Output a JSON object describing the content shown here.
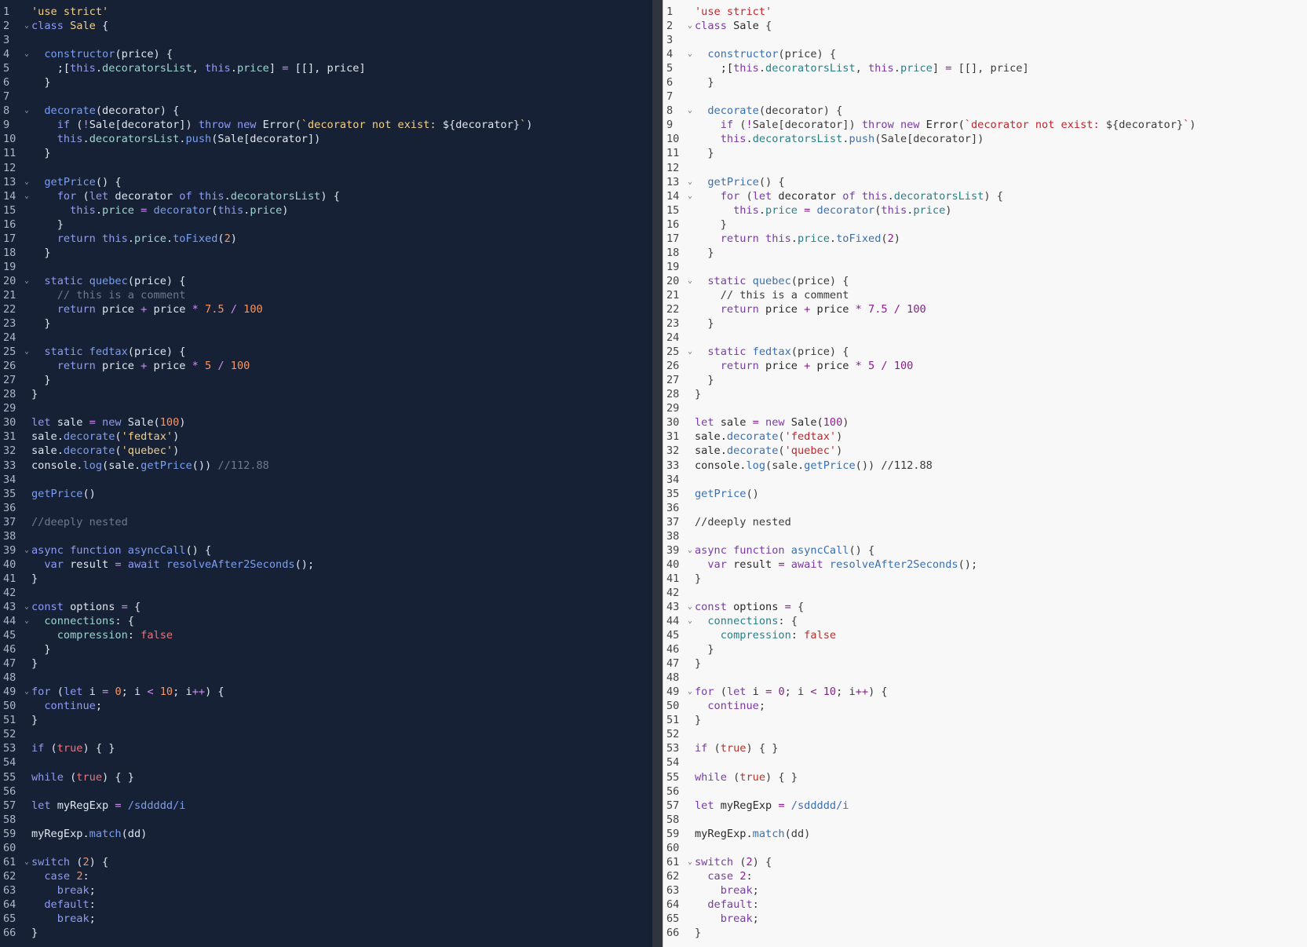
{
  "editors": [
    {
      "name": "dark-editor",
      "theme": "dark",
      "background": "#172136"
    },
    {
      "name": "light-editor",
      "theme": "light",
      "background": "#f8f8f8"
    }
  ],
  "fold_icon": "chevron-down-icon",
  "lines": [
    {
      "n": "1",
      "fold": false,
      "tokens": [
        [
          "str",
          "'use strict'"
        ]
      ]
    },
    {
      "n": "2",
      "fold": true,
      "tokens": [
        [
          "kw",
          "class"
        ],
        [
          "txt",
          " "
        ],
        [
          "cls",
          "Sale"
        ],
        [
          "pun",
          " {"
        ]
      ]
    },
    {
      "n": "3",
      "fold": false,
      "tokens": []
    },
    {
      "n": "4",
      "fold": true,
      "tokens": [
        [
          "txt",
          "  "
        ],
        [
          "fn",
          "constructor"
        ],
        [
          "pun",
          "(price) {"
        ]
      ]
    },
    {
      "n": "5",
      "fold": false,
      "tokens": [
        [
          "txt",
          "    ;["
        ],
        [
          "kw",
          "this"
        ],
        [
          "pun",
          "."
        ],
        [
          "prop",
          "decoratorsList"
        ],
        [
          "pun",
          ", "
        ],
        [
          "kw",
          "this"
        ],
        [
          "pun",
          "."
        ],
        [
          "prop",
          "price"
        ],
        [
          "pun",
          "] "
        ],
        [
          "op",
          "="
        ],
        [
          "pun",
          " [[], price]"
        ]
      ]
    },
    {
      "n": "6",
      "fold": false,
      "tokens": [
        [
          "pun",
          "  }"
        ]
      ]
    },
    {
      "n": "7",
      "fold": false,
      "tokens": []
    },
    {
      "n": "8",
      "fold": true,
      "tokens": [
        [
          "txt",
          "  "
        ],
        [
          "fn",
          "decorate"
        ],
        [
          "pun",
          "(decorator) {"
        ]
      ]
    },
    {
      "n": "9",
      "fold": false,
      "tokens": [
        [
          "txt",
          "    "
        ],
        [
          "kw",
          "if"
        ],
        [
          "pun",
          " ("
        ],
        [
          "op",
          "!"
        ],
        [
          "pun",
          "Sale[decorator]) "
        ],
        [
          "kw",
          "throw"
        ],
        [
          "txt",
          " "
        ],
        [
          "kw",
          "new"
        ],
        [
          "txt",
          " Error("
        ],
        [
          "str",
          "`decorator not exist: "
        ],
        [
          "pun",
          "${decorator}"
        ],
        [
          "str",
          "`"
        ],
        [
          "pun",
          ")"
        ]
      ]
    },
    {
      "n": "10",
      "fold": false,
      "tokens": [
        [
          "txt",
          "    "
        ],
        [
          "kw",
          "this"
        ],
        [
          "pun",
          "."
        ],
        [
          "prop",
          "decoratorsList"
        ],
        [
          "pun",
          "."
        ],
        [
          "fn",
          "push"
        ],
        [
          "pun",
          "(Sale[decorator])"
        ]
      ]
    },
    {
      "n": "11",
      "fold": false,
      "tokens": [
        [
          "pun",
          "  }"
        ]
      ]
    },
    {
      "n": "12",
      "fold": false,
      "tokens": []
    },
    {
      "n": "13",
      "fold": true,
      "tokens": [
        [
          "txt",
          "  "
        ],
        [
          "fn",
          "getPrice"
        ],
        [
          "pun",
          "() {"
        ]
      ]
    },
    {
      "n": "14",
      "fold": true,
      "tokens": [
        [
          "txt",
          "    "
        ],
        [
          "kw",
          "for"
        ],
        [
          "pun",
          " ("
        ],
        [
          "kw",
          "let"
        ],
        [
          "txt",
          " decorator "
        ],
        [
          "kw",
          "of"
        ],
        [
          "txt",
          " "
        ],
        [
          "kw",
          "this"
        ],
        [
          "pun",
          "."
        ],
        [
          "prop",
          "decoratorsList"
        ],
        [
          "pun",
          ") {"
        ]
      ]
    },
    {
      "n": "15",
      "fold": false,
      "tokens": [
        [
          "txt",
          "      "
        ],
        [
          "kw",
          "this"
        ],
        [
          "pun",
          "."
        ],
        [
          "prop",
          "price"
        ],
        [
          "txt",
          " "
        ],
        [
          "op",
          "="
        ],
        [
          "txt",
          " "
        ],
        [
          "fn",
          "decorator"
        ],
        [
          "pun",
          "("
        ],
        [
          "kw",
          "this"
        ],
        [
          "pun",
          "."
        ],
        [
          "prop",
          "price"
        ],
        [
          "pun",
          ")"
        ]
      ]
    },
    {
      "n": "16",
      "fold": false,
      "tokens": [
        [
          "pun",
          "    }"
        ]
      ]
    },
    {
      "n": "17",
      "fold": false,
      "tokens": [
        [
          "txt",
          "    "
        ],
        [
          "kw",
          "return"
        ],
        [
          "txt",
          " "
        ],
        [
          "kw",
          "this"
        ],
        [
          "pun",
          "."
        ],
        [
          "prop",
          "price"
        ],
        [
          "pun",
          "."
        ],
        [
          "fn",
          "toFixed"
        ],
        [
          "pun",
          "("
        ],
        [
          "num",
          "2"
        ],
        [
          "pun",
          ")"
        ]
      ]
    },
    {
      "n": "18",
      "fold": false,
      "tokens": [
        [
          "pun",
          "  }"
        ]
      ]
    },
    {
      "n": "19",
      "fold": false,
      "tokens": []
    },
    {
      "n": "20",
      "fold": true,
      "tokens": [
        [
          "txt",
          "  "
        ],
        [
          "kw",
          "static"
        ],
        [
          "txt",
          " "
        ],
        [
          "fn",
          "quebec"
        ],
        [
          "pun",
          "(price) {"
        ]
      ]
    },
    {
      "n": "21",
      "fold": false,
      "tokens": [
        [
          "txt",
          "    "
        ],
        [
          "com",
          "// this is a comment"
        ]
      ]
    },
    {
      "n": "22",
      "fold": false,
      "tokens": [
        [
          "txt",
          "    "
        ],
        [
          "kw",
          "return"
        ],
        [
          "txt",
          " price "
        ],
        [
          "op",
          "+"
        ],
        [
          "txt",
          " price "
        ],
        [
          "op",
          "*"
        ],
        [
          "txt",
          " "
        ],
        [
          "num",
          "7.5"
        ],
        [
          "txt",
          " "
        ],
        [
          "op",
          "/"
        ],
        [
          "txt",
          " "
        ],
        [
          "num",
          "100"
        ]
      ]
    },
    {
      "n": "23",
      "fold": false,
      "tokens": [
        [
          "pun",
          "  }"
        ]
      ]
    },
    {
      "n": "24",
      "fold": false,
      "tokens": []
    },
    {
      "n": "25",
      "fold": true,
      "tokens": [
        [
          "txt",
          "  "
        ],
        [
          "kw",
          "static"
        ],
        [
          "txt",
          " "
        ],
        [
          "fn",
          "fedtax"
        ],
        [
          "pun",
          "(price) {"
        ]
      ]
    },
    {
      "n": "26",
      "fold": false,
      "tokens": [
        [
          "txt",
          "    "
        ],
        [
          "kw",
          "return"
        ],
        [
          "txt",
          " price "
        ],
        [
          "op",
          "+"
        ],
        [
          "txt",
          " price "
        ],
        [
          "op",
          "*"
        ],
        [
          "txt",
          " "
        ],
        [
          "num",
          "5"
        ],
        [
          "txt",
          " "
        ],
        [
          "op",
          "/"
        ],
        [
          "txt",
          " "
        ],
        [
          "num",
          "100"
        ]
      ]
    },
    {
      "n": "27",
      "fold": false,
      "tokens": [
        [
          "pun",
          "  }"
        ]
      ]
    },
    {
      "n": "28",
      "fold": false,
      "tokens": [
        [
          "pun",
          "}"
        ]
      ]
    },
    {
      "n": "29",
      "fold": false,
      "tokens": []
    },
    {
      "n": "30",
      "fold": false,
      "tokens": [
        [
          "kw",
          "let"
        ],
        [
          "txt",
          " sale "
        ],
        [
          "op",
          "="
        ],
        [
          "txt",
          " "
        ],
        [
          "kw",
          "new"
        ],
        [
          "txt",
          " Sale("
        ],
        [
          "num",
          "100"
        ],
        [
          "pun",
          ")"
        ]
      ]
    },
    {
      "n": "31",
      "fold": false,
      "tokens": [
        [
          "txt",
          "sale."
        ],
        [
          "fn",
          "decorate"
        ],
        [
          "pun",
          "("
        ],
        [
          "str",
          "'fedtax'"
        ],
        [
          "pun",
          ")"
        ]
      ]
    },
    {
      "n": "32",
      "fold": false,
      "tokens": [
        [
          "txt",
          "sale."
        ],
        [
          "fn",
          "decorate"
        ],
        [
          "pun",
          "("
        ],
        [
          "str",
          "'quebec'"
        ],
        [
          "pun",
          ")"
        ]
      ]
    },
    {
      "n": "33",
      "fold": false,
      "tokens": [
        [
          "txt",
          "console."
        ],
        [
          "fn",
          "log"
        ],
        [
          "pun",
          "(sale."
        ],
        [
          "fn",
          "getPrice"
        ],
        [
          "pun",
          "()) "
        ],
        [
          "com",
          "//112.88"
        ]
      ]
    },
    {
      "n": "34",
      "fold": false,
      "tokens": []
    },
    {
      "n": "35",
      "fold": false,
      "tokens": [
        [
          "fn",
          "getPrice"
        ],
        [
          "pun",
          "()"
        ]
      ]
    },
    {
      "n": "36",
      "fold": false,
      "tokens": []
    },
    {
      "n": "37",
      "fold": false,
      "tokens": [
        [
          "com",
          "//deeply nested"
        ]
      ]
    },
    {
      "n": "38",
      "fold": false,
      "tokens": []
    },
    {
      "n": "39",
      "fold": true,
      "tokens": [
        [
          "kw",
          "async"
        ],
        [
          "txt",
          " "
        ],
        [
          "kw",
          "function"
        ],
        [
          "txt",
          " "
        ],
        [
          "fn",
          "asyncCall"
        ],
        [
          "pun",
          "() {"
        ]
      ]
    },
    {
      "n": "40",
      "fold": false,
      "tokens": [
        [
          "txt",
          "  "
        ],
        [
          "kw",
          "var"
        ],
        [
          "txt",
          " result "
        ],
        [
          "op",
          "="
        ],
        [
          "txt",
          " "
        ],
        [
          "kw",
          "await"
        ],
        [
          "txt",
          " "
        ],
        [
          "fn",
          "resolveAfter2Seconds"
        ],
        [
          "pun",
          "();"
        ]
      ]
    },
    {
      "n": "41",
      "fold": false,
      "tokens": [
        [
          "pun",
          "}"
        ]
      ]
    },
    {
      "n": "42",
      "fold": false,
      "tokens": []
    },
    {
      "n": "43",
      "fold": true,
      "tokens": [
        [
          "kw",
          "const"
        ],
        [
          "txt",
          " options "
        ],
        [
          "op",
          "="
        ],
        [
          "pun",
          " {"
        ]
      ]
    },
    {
      "n": "44",
      "fold": true,
      "tokens": [
        [
          "txt",
          "  "
        ],
        [
          "prop",
          "connections"
        ],
        [
          "pun",
          ": {"
        ]
      ]
    },
    {
      "n": "45",
      "fold": false,
      "tokens": [
        [
          "txt",
          "    "
        ],
        [
          "prop",
          "compression"
        ],
        [
          "pun",
          ": "
        ],
        [
          "lit",
          "false"
        ]
      ]
    },
    {
      "n": "46",
      "fold": false,
      "tokens": [
        [
          "pun",
          "  }"
        ]
      ]
    },
    {
      "n": "47",
      "fold": false,
      "tokens": [
        [
          "pun",
          "}"
        ]
      ]
    },
    {
      "n": "48",
      "fold": false,
      "tokens": []
    },
    {
      "n": "49",
      "fold": true,
      "tokens": [
        [
          "kw",
          "for"
        ],
        [
          "pun",
          " ("
        ],
        [
          "kw",
          "let"
        ],
        [
          "txt",
          " i "
        ],
        [
          "op",
          "="
        ],
        [
          "txt",
          " "
        ],
        [
          "num",
          "0"
        ],
        [
          "pun",
          "; i "
        ],
        [
          "op",
          "<"
        ],
        [
          "txt",
          " "
        ],
        [
          "num",
          "10"
        ],
        [
          "pun",
          "; i"
        ],
        [
          "op",
          "++"
        ],
        [
          "pun",
          ") {"
        ]
      ]
    },
    {
      "n": "50",
      "fold": false,
      "tokens": [
        [
          "txt",
          "  "
        ],
        [
          "kw",
          "continue"
        ],
        [
          "pun",
          ";"
        ]
      ]
    },
    {
      "n": "51",
      "fold": false,
      "tokens": [
        [
          "pun",
          "}"
        ]
      ]
    },
    {
      "n": "52",
      "fold": false,
      "tokens": []
    },
    {
      "n": "53",
      "fold": false,
      "tokens": [
        [
          "kw",
          "if"
        ],
        [
          "pun",
          " ("
        ],
        [
          "lit",
          "true"
        ],
        [
          "pun",
          ") { }"
        ]
      ]
    },
    {
      "n": "54",
      "fold": false,
      "tokens": []
    },
    {
      "n": "55",
      "fold": false,
      "tokens": [
        [
          "kw",
          "while"
        ],
        [
          "pun",
          " ("
        ],
        [
          "lit",
          "true"
        ],
        [
          "pun",
          ") { }"
        ]
      ]
    },
    {
      "n": "56",
      "fold": false,
      "tokens": []
    },
    {
      "n": "57",
      "fold": false,
      "tokens": [
        [
          "kw",
          "let"
        ],
        [
          "txt",
          " myRegExp "
        ],
        [
          "op",
          "="
        ],
        [
          "txt",
          " "
        ],
        [
          "re",
          "/sddddd/i"
        ]
      ]
    },
    {
      "n": "58",
      "fold": false,
      "tokens": []
    },
    {
      "n": "59",
      "fold": false,
      "tokens": [
        [
          "txt",
          "myRegExp."
        ],
        [
          "fn",
          "match"
        ],
        [
          "pun",
          "(dd)"
        ]
      ]
    },
    {
      "n": "60",
      "fold": false,
      "tokens": []
    },
    {
      "n": "61",
      "fold": true,
      "tokens": [
        [
          "kw",
          "switch"
        ],
        [
          "pun",
          " ("
        ],
        [
          "num",
          "2"
        ],
        [
          "pun",
          ") {"
        ]
      ]
    },
    {
      "n": "62",
      "fold": false,
      "tokens": [
        [
          "txt",
          "  "
        ],
        [
          "kw",
          "case"
        ],
        [
          "txt",
          " "
        ],
        [
          "num",
          "2"
        ],
        [
          "pun",
          ":"
        ]
      ]
    },
    {
      "n": "63",
      "fold": false,
      "tokens": [
        [
          "txt",
          "    "
        ],
        [
          "kw",
          "break"
        ],
        [
          "pun",
          ";"
        ]
      ]
    },
    {
      "n": "64",
      "fold": false,
      "tokens": [
        [
          "txt",
          "  "
        ],
        [
          "kw",
          "default"
        ],
        [
          "pun",
          ":"
        ]
      ]
    },
    {
      "n": "65",
      "fold": false,
      "tokens": [
        [
          "txt",
          "    "
        ],
        [
          "kw",
          "break"
        ],
        [
          "pun",
          ";"
        ]
      ]
    },
    {
      "n": "66",
      "fold": false,
      "tokens": [
        [
          "pun",
          "}"
        ]
      ]
    }
  ]
}
